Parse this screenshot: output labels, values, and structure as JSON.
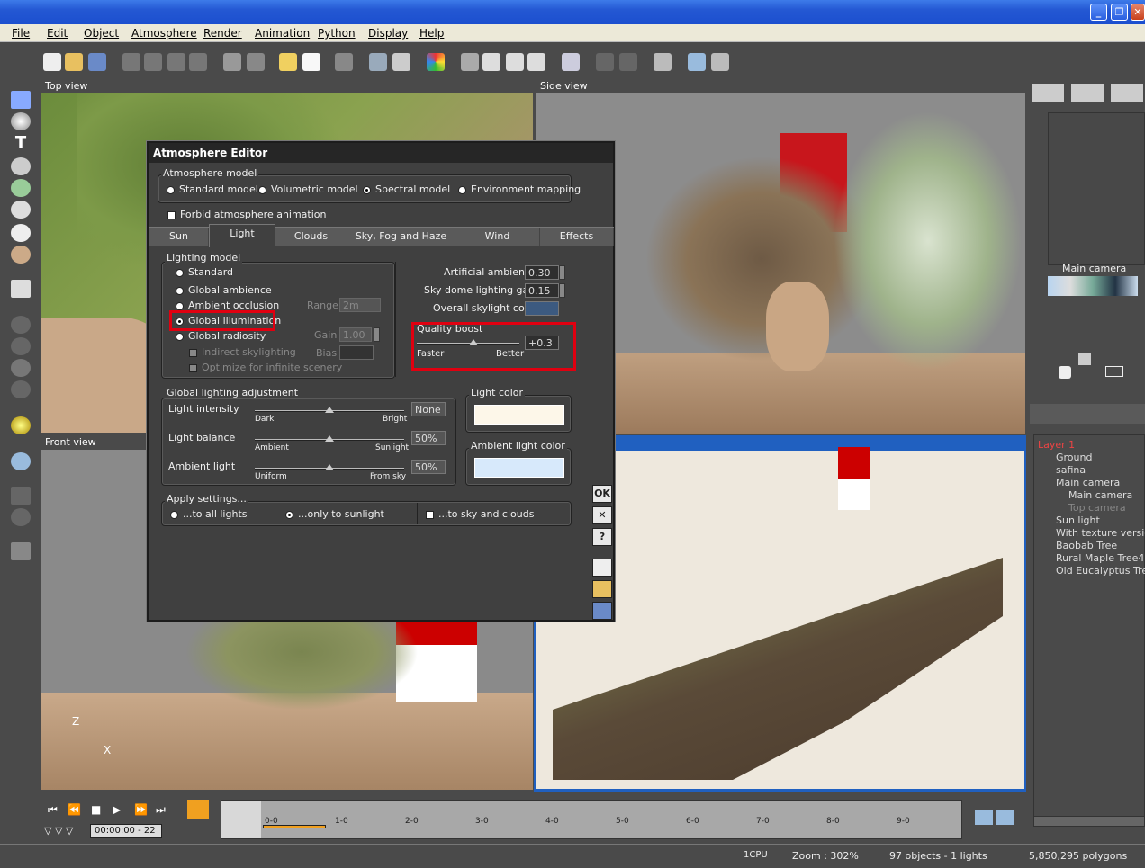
{
  "menubar": [
    "File",
    "Edit",
    "Object",
    "Atmosphere",
    "Render",
    "Animation",
    "Python",
    "Display",
    "Help"
  ],
  "viewports": {
    "top_left": "Top view",
    "top_right": "Side view",
    "bottom_left": "Front view",
    "bottom_right": "Main camera"
  },
  "axes": {
    "z": "Z",
    "x": "X"
  },
  "dialog": {
    "title": "Atmosphere Editor",
    "atmosphere_model": {
      "label": "Atmosphere model",
      "options": [
        "Standard model",
        "Volumetric model",
        "Spectral model",
        "Environment mapping"
      ],
      "selected": "Spectral model"
    },
    "forbid_anim": "Forbid atmosphere animation",
    "tabs": [
      "Sun",
      "Light",
      "Clouds",
      "Sky, Fog and Haze",
      "Wind",
      "Effects"
    ],
    "active_tab": "Light",
    "lighting_model": {
      "label": "Lighting model",
      "options": [
        "Standard",
        "Global ambience",
        "Ambient occlusion",
        "Global illumination",
        "Global radiosity"
      ],
      "selected": "Global illumination",
      "range_label": "Range",
      "range_value": "2m",
      "gain_label": "Gain",
      "gain_value": "1.00",
      "bias_label": "Bias",
      "indirect": "Indirect skylighting",
      "optimize": "Optimize for infinite scenery"
    },
    "artificial_ambience": {
      "label": "Artificial ambience",
      "value": "0.30"
    },
    "sky_dome_gain": {
      "label": "Sky dome lighting gain",
      "value": "0.15"
    },
    "overall_skylight": {
      "label": "Overall skylight color",
      "color": "#3c5a80"
    },
    "quality_boost": {
      "label": "Quality boost",
      "value": "+0.3",
      "min": "Faster",
      "max": "Better",
      "level": 0.55
    },
    "global_adjust": {
      "label": "Global lighting adjustment",
      "rows": [
        {
          "label": "Light intensity",
          "left": "Dark",
          "right": "Bright",
          "value": "None"
        },
        {
          "label": "Light balance",
          "left": "Ambient",
          "right": "Sunlight",
          "value": "50%"
        },
        {
          "label": "Ambient light",
          "left": "Uniform",
          "right": "From sky",
          "value": "50%"
        }
      ]
    },
    "light_color": {
      "label": "Light color",
      "color": "#fdf7e9"
    },
    "ambient_light_color": {
      "label": "Ambient light color",
      "color": "#d7e9fb"
    },
    "apply": {
      "label": "Apply settings...",
      "options": [
        "...to all lights",
        "...only to sunlight",
        "...to sky and clouds"
      ],
      "selected": "...only to sunlight"
    },
    "buttons": {
      "ok": "OK",
      "cancel": "✕",
      "help": "?"
    }
  },
  "right_panel": {
    "camera_label": "Main camera",
    "tree": [
      "Layer 1",
      "Ground",
      "safina",
      "Main camera",
      "Main camera",
      "Top camera",
      "Sun light",
      "With texture version",
      "Baobab Tree",
      "Rural Maple Tree4",
      "Old Eucalyptus Tree"
    ]
  },
  "timeline": {
    "time": "00:00:00 - 22",
    "ticks": [
      "0-0",
      "1-0",
      "2-0",
      "3-0",
      "4-0",
      "5-0",
      "6-0",
      "7-0",
      "8-0",
      "9-0"
    ]
  },
  "status": {
    "cpu": "1CPU",
    "zoom": "Zoom : 302%",
    "objects": "97 objects - 1 lights",
    "polygons": "5,850,295 polygons"
  },
  "colors": {
    "highlight": "#e00010",
    "selected_viewport": "#2060c0"
  }
}
